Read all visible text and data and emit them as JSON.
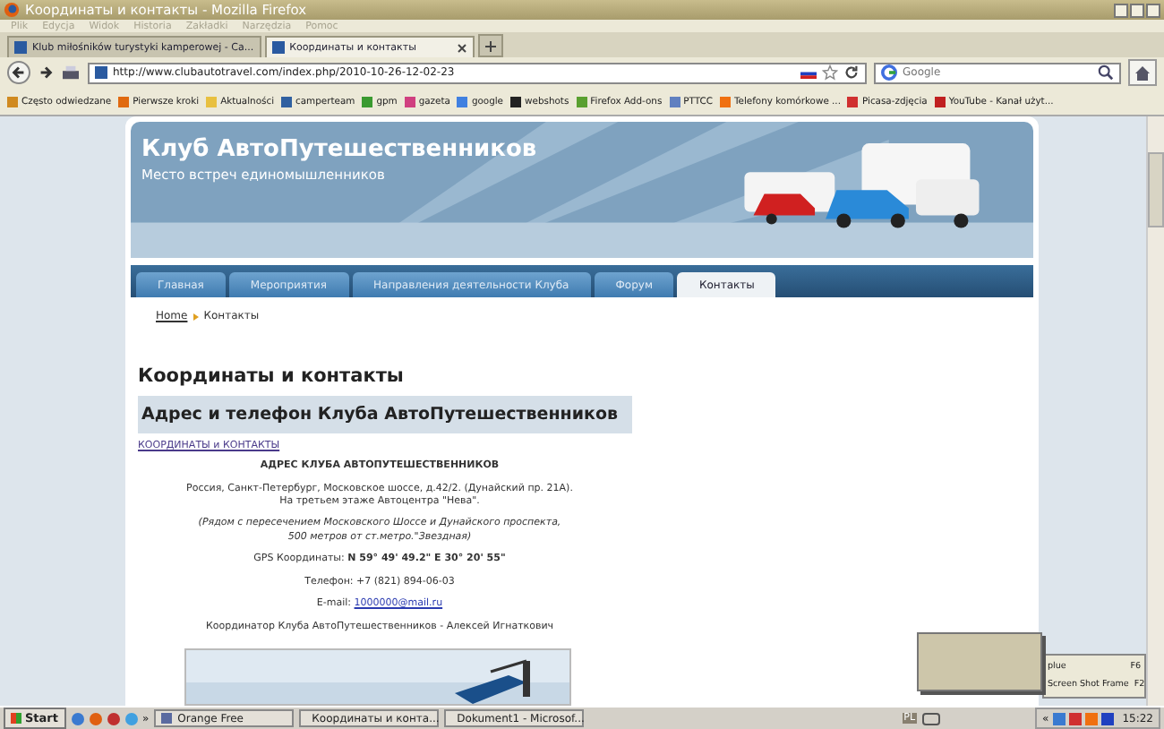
{
  "window": {
    "title": "Координаты и контакты - Mozilla Firefox"
  },
  "menu": [
    "Plik",
    "Edycja",
    "Widok",
    "Historia",
    "Zakładki",
    "Narzędzia",
    "Pomoc"
  ],
  "tabs": [
    {
      "label": "Klub miłośników turystyki kamperowej - Ca...",
      "selected": false
    },
    {
      "label": "Координаты и контакты",
      "selected": true
    }
  ],
  "address": {
    "url": "http://www.clubautotravel.com/index.php/2010-10-26-12-02-23"
  },
  "search": {
    "placeholder": "Google"
  },
  "bookmarks": [
    "Często odwiedzane",
    "Pierwsze kroki",
    "Aktualności",
    "camperteam",
    "gpm",
    "gazeta",
    "google",
    "webshots",
    "Firefox Add-ons",
    "PTTCC",
    "Telefony komórkowe ...",
    "Picasa-zdjęcia",
    "YouTube - Kanał użyt..."
  ],
  "page": {
    "site_title": "Клуб АвтоПутешественников",
    "tagline": "Место встреч единомышленников",
    "nav": [
      {
        "label": "Главная",
        "selected": false
      },
      {
        "label": "Мероприятия",
        "selected": false
      },
      {
        "label": "Направления деятельности Клуба",
        "selected": false
      },
      {
        "label": "Форум",
        "selected": false
      },
      {
        "label": "Контакты",
        "selected": true
      }
    ],
    "breadcrumb": {
      "home": "Home",
      "current": "Контакты"
    },
    "heading": "Координаты и контакты",
    "section_heading": "Адрес и телефон Клуба АвтоПутешественников",
    "section_link": "КООРДИНАТЫ и КОНТАКТЫ",
    "address_block": [
      {
        "kind": "heading",
        "text": "АДРЕС КЛУБА АВТОПУТЕШЕСТВЕННИКОВ"
      },
      {
        "kind": "plain",
        "text": "Россия, Санкт-Петербург, Московское шоссе, д.42/2. (Дунайский пр. 21А).\nНа третьем этаже Автоцентра \"Нева\"."
      },
      {
        "kind": "italic",
        "text": "(Рядом с пересечением  Московского Шоссе и Дунайского проспекта,\n500 метров от ст.метро.\"Звездная)"
      },
      {
        "kind": "plain",
        "text": "GPS Координаты: **N 59° 49' 49.2\"  E 30° 20' 55\"**"
      },
      {
        "kind": "plain",
        "text": "Телефон: +7 (821) 894-06-03"
      },
      {
        "kind": "email",
        "text": "E-mail:",
        "link": "1000000@mail.ru"
      },
      {
        "kind": "plain",
        "text": "Координатор Клуба АвтоПутешественников - Алексей Игнаткович"
      }
    ]
  },
  "popup_menu": [
    {
      "label": "plue",
      "shortcut": "F6"
    },
    {
      "label": "Screen Shot Frame",
      "shortcut": "F2"
    }
  ],
  "taskbar": {
    "start": "Start",
    "more": "»",
    "tasks": [
      "Orange Free",
      "Координаты и конта...",
      "Dokument1 - Microsof..."
    ],
    "language": "PL",
    "more_tray": "«",
    "clock": "15:22"
  }
}
